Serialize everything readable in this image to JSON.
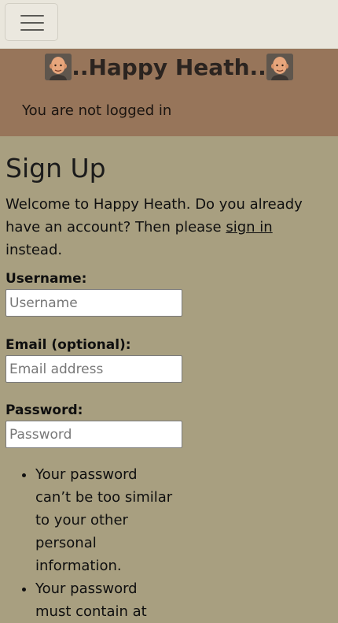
{
  "nav": {
    "menu_icon": "hamburger-menu-icon"
  },
  "header": {
    "title": "..Happy Heath..",
    "avatar_icon": "bald-man-avatar-icon",
    "login_status": "You are not logged in"
  },
  "main": {
    "title": "Sign Up",
    "intro_before": "Welcome to Happy Heath. Do you already have an account? Then please ",
    "intro_link": "sign in",
    "intro_after": " instead.",
    "fields": [
      {
        "label": "Username:",
        "placeholder": "Username",
        "value": ""
      },
      {
        "label": "Email (optional):",
        "placeholder": "Email address",
        "value": ""
      },
      {
        "label": "Password:",
        "placeholder": "Password",
        "value": ""
      }
    ],
    "password_help": [
      "Your password can’t be too similar to your other personal information.",
      "Your password must contain at"
    ]
  },
  "colors": {
    "topbar": "#e9e6dc",
    "header": "#97755a",
    "page": "#a89f80"
  }
}
